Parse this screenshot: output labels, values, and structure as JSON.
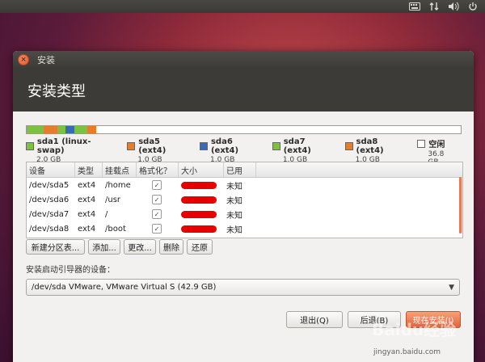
{
  "panel": {
    "keyboard_icon": "keyboard-icon",
    "network_icon": "network-arrows-icon",
    "volume_icon": "volume-icon",
    "power_icon": "power-icon"
  },
  "window": {
    "title": "安装",
    "header": "安装类型"
  },
  "partition_bar": [
    {
      "color": "#7dc142",
      "fraction": 0.04
    },
    {
      "color": "#e57e2a",
      "fraction": 0.03
    },
    {
      "color": "#7dc142",
      "fraction": 0.02
    },
    {
      "color": "#3a6ab5",
      "fraction": 0.02
    },
    {
      "color": "#7dc142",
      "fraction": 0.03
    },
    {
      "color": "#e57e2a",
      "fraction": 0.02
    },
    {
      "color": "#ffffff",
      "fraction": 0.84
    }
  ],
  "legend": [
    {
      "name": "sda1 (linux-swap)",
      "size": "2.0 GB",
      "color": "#7dc142"
    },
    {
      "name": "sda5 (ext4)",
      "size": "1.0 GB",
      "color": "#e57e2a"
    },
    {
      "name": "sda6 (ext4)",
      "size": "1.0 GB",
      "color": "#3a6ab5"
    },
    {
      "name": "sda7 (ext4)",
      "size": "1.0 GB",
      "color": "#7dc142"
    },
    {
      "name": "sda8 (ext4)",
      "size": "1.0 GB",
      "color": "#e57e2a"
    },
    {
      "name": "空闲",
      "size": "36.8 GB",
      "color": "#ffffff"
    }
  ],
  "table": {
    "headers": [
      "设备",
      "类型",
      "挂载点",
      "格式化？",
      "大小",
      "已用"
    ],
    "rows": [
      {
        "device": "/dev/sda5",
        "type": "ext4",
        "mount": "/home",
        "used": "未知"
      },
      {
        "device": "/dev/sda6",
        "type": "ext4",
        "mount": "/usr",
        "used": "未知"
      },
      {
        "device": "/dev/sda7",
        "type": "ext4",
        "mount": "/",
        "used": "未知"
      },
      {
        "device": "/dev/sda8",
        "type": "ext4",
        "mount": "/boot",
        "used": "未知"
      }
    ]
  },
  "actions": {
    "new_table": "新建分区表...",
    "add": "添加...",
    "change": "更改...",
    "delete": "删除",
    "revert": "还原"
  },
  "boot": {
    "label": "安装启动引导器的设备：",
    "device": "/dev/sda    VMware, VMware Virtual S (42.9 GB)"
  },
  "nav": {
    "quit": "退出(Q)",
    "back": "后退(B)",
    "install": "现在安装(I)"
  },
  "watermark": {
    "text": "Baidu经验",
    "url": "jingyan.baidu.com"
  }
}
